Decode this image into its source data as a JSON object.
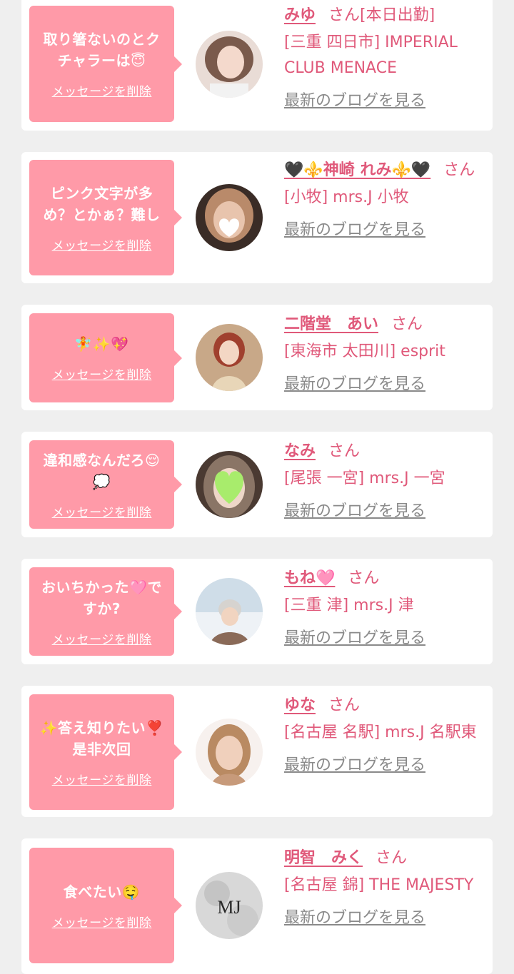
{
  "common": {
    "delete_label": "メッセージを削除",
    "blog_label": "最新のブログを見る"
  },
  "items": [
    {
      "message": "取り箸ないのとクチャラーは😇",
      "name": "みゆ",
      "honorific": "さん",
      "status": "[本日出勤]",
      "shop": "[三重 四日市] IMPERIAL CLUB MENACE"
    },
    {
      "message": "ピンク文字が多め？とかぁ？難し",
      "name": "🖤⚜️神崎 れみ⚜️🖤",
      "honorific": "さん",
      "status": "",
      "shop": "[小牧] mrs.J 小牧"
    },
    {
      "message": "🧚✨💖",
      "name": "二階堂　あい",
      "honorific": "さん",
      "status": "",
      "shop": "[東海市 太田川] esprit"
    },
    {
      "message": "違和感なんだろ😌💭",
      "name": "なみ",
      "honorific": "さん",
      "status": "",
      "shop": "[尾張 一宮] mrs.J 一宮"
    },
    {
      "message": "おいちかった🩷ですか?",
      "name": "もね🩷",
      "honorific": "さん",
      "status": "",
      "shop": "[三重 津] mrs.J 津"
    },
    {
      "message": "✨答え知りたい❣️是非次回",
      "name": "ゆな",
      "honorific": "さん",
      "status": "",
      "shop": "[名古屋 名駅] mrs.J 名駅東"
    },
    {
      "message": "食べたい🤤",
      "name": "明智　みく",
      "honorific": "さん",
      "status": "",
      "shop": "[名古屋 錦] THE MAJESTY",
      "avatar_logo_text": "MJ"
    }
  ]
}
